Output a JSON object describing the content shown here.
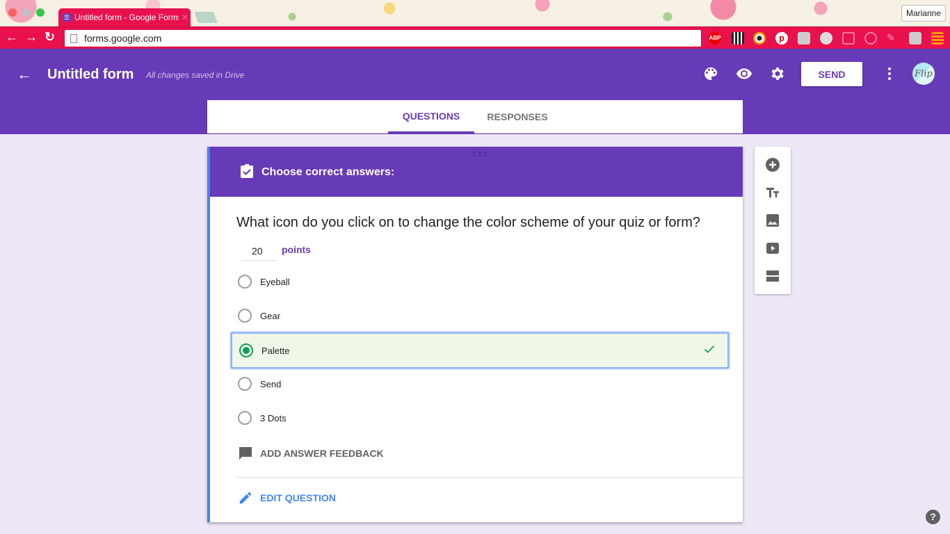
{
  "browser": {
    "tab_title": "Untitled form - Google Forms",
    "url": "forms.google.com",
    "profile_name": "Marianne",
    "extensions": [
      "adblock-plus-icon",
      "qr-code-icon",
      "color-picker-icon",
      "pinterest-icon",
      "qr-noise-icon",
      "circle-ext-icon",
      "ribbon-ext-icon",
      "search-screenshot-icon",
      "pen-ext-icon",
      "wand-ext-icon",
      "menu-ext-icon"
    ],
    "extension_labels": {
      "adblock": "ABP"
    }
  },
  "header": {
    "title": "Untitled form",
    "save_status": "All changes saved in Drive",
    "send_label": "SEND",
    "avatar_text": "Flip",
    "brand_color": "#673ab7"
  },
  "tabs": [
    {
      "label": "QUESTIONS",
      "active": true
    },
    {
      "label": "RESPONSES",
      "active": false
    }
  ],
  "question_card": {
    "header_title": "Choose correct answers:",
    "question": "What icon do you click on to change the color scheme of your quiz or form?",
    "points_value": "20",
    "points_label": "points",
    "options": [
      {
        "label": "Eyeball",
        "correct": false
      },
      {
        "label": "Gear",
        "correct": false
      },
      {
        "label": "Palette",
        "correct": true
      },
      {
        "label": "Send",
        "correct": false
      },
      {
        "label": "3 Dots",
        "correct": false
      }
    ],
    "feedback_label": "ADD ANSWER FEEDBACK",
    "edit_label": "EDIT QUESTION",
    "correct_color": "#0f9d58"
  },
  "side_tools": [
    "add-question-icon",
    "add-title-icon",
    "add-image-icon",
    "add-video-icon",
    "add-section-icon"
  ],
  "help_label": "?"
}
